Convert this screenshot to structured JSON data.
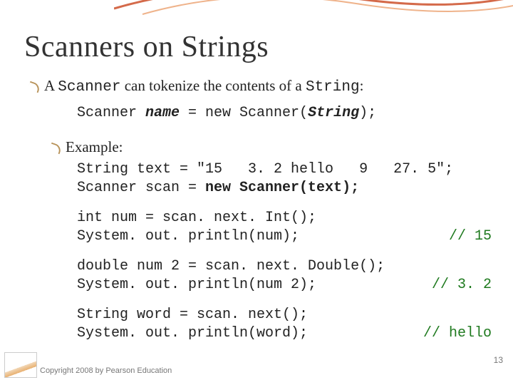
{
  "title": "Scanners on Strings",
  "line1": {
    "pre": "A ",
    "scanner": "Scanner",
    "mid": " can tokenize the contents of a ",
    "string": "String",
    "post": ":"
  },
  "syntax": {
    "part1": "Scanner ",
    "name": "name",
    "part2": " = new Scanner(",
    "param": "String",
    "part3": ");"
  },
  "example_label": "Example:",
  "code": {
    "l1": "String text = \"15   3. 2 hello   9   27. 5\";",
    "l2a": "Scanner scan = ",
    "l2b": "new Scanner(text);",
    "l3": "int num = scan. next. Int();",
    "l4": "System. out. println(num);",
    "c4": "// 15",
    "l5": "double num 2 = scan. next. Double();",
    "l6": "System. out. println(num 2);",
    "c6": "// 3. 2",
    "l7": "String word = scan. next();",
    "l8": "System. out. println(word);",
    "c8": "// hello"
  },
  "pagenum": "13",
  "copyright": "Copyright 2008 by Pearson Education"
}
